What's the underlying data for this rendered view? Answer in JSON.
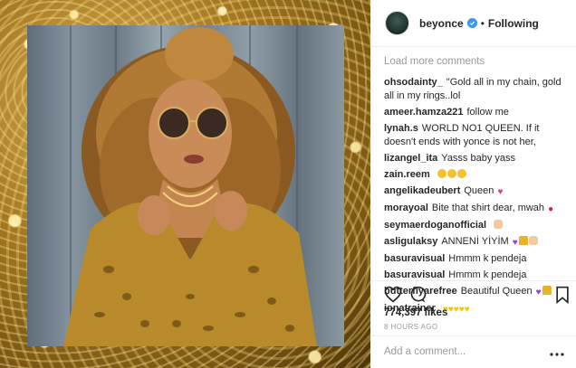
{
  "post": {
    "username": "beyonce",
    "follow_state": "Following",
    "separator": "•"
  },
  "comments_panel": {
    "load_more": "Load more comments",
    "items": [
      {
        "user": "ohsodainty_",
        "text": "\"Gold all in my chain, gold all in my rings..lol",
        "emoji": ""
      },
      {
        "user": "ameer.hamza221",
        "text": "follow me",
        "emoji": ""
      },
      {
        "user": "lynah.s",
        "text": "WORLD NO1 QUEEN. If it doesn't ends with yonce is not her,",
        "emoji": ""
      },
      {
        "user": "lizangel_ita",
        "text": "Yasss baby yass",
        "emoji": ""
      },
      {
        "user": "zain.reem",
        "text": "",
        "emoji": "face-heart-eyes x3"
      },
      {
        "user": "angelikadeubert",
        "text": "Queen",
        "emoji": "sparkling-heart"
      },
      {
        "user": "morayoal",
        "text": "Bite that shirt dear, mwah",
        "emoji": "kiss-lips"
      },
      {
        "user": "seymaerdoganofficial",
        "text": "",
        "emoji": "thumbs-up"
      },
      {
        "user": "asligulaksy",
        "text": "ANNENİ YİYİM",
        "emoji": "purple-heart crown ok-hand"
      },
      {
        "user": "basuravisual",
        "text": "Hmmm k pendeja",
        "emoji": ""
      },
      {
        "user": "basuravisual",
        "text": "Hmmm k pendeja",
        "emoji": ""
      },
      {
        "user": "butterflyarefree",
        "text": "Beautiful Queen",
        "emoji": "purple-heart crown"
      },
      {
        "user": "ionatrainer",
        "text": "",
        "emoji": "yellow-heart x5"
      }
    ]
  },
  "actions": {
    "icons": [
      "heart-icon",
      "comment-icon",
      "bookmark-icon",
      "more-options-icon"
    ]
  },
  "likes": "774,397 likes",
  "timestamp": "8 HOURS AGO",
  "add_comment": {
    "placeholder": "Add a comment..."
  },
  "colors": {
    "link_blue": "#3897f0",
    "muted_gray": "#999999",
    "text": "#262626",
    "divider": "#efefef"
  }
}
